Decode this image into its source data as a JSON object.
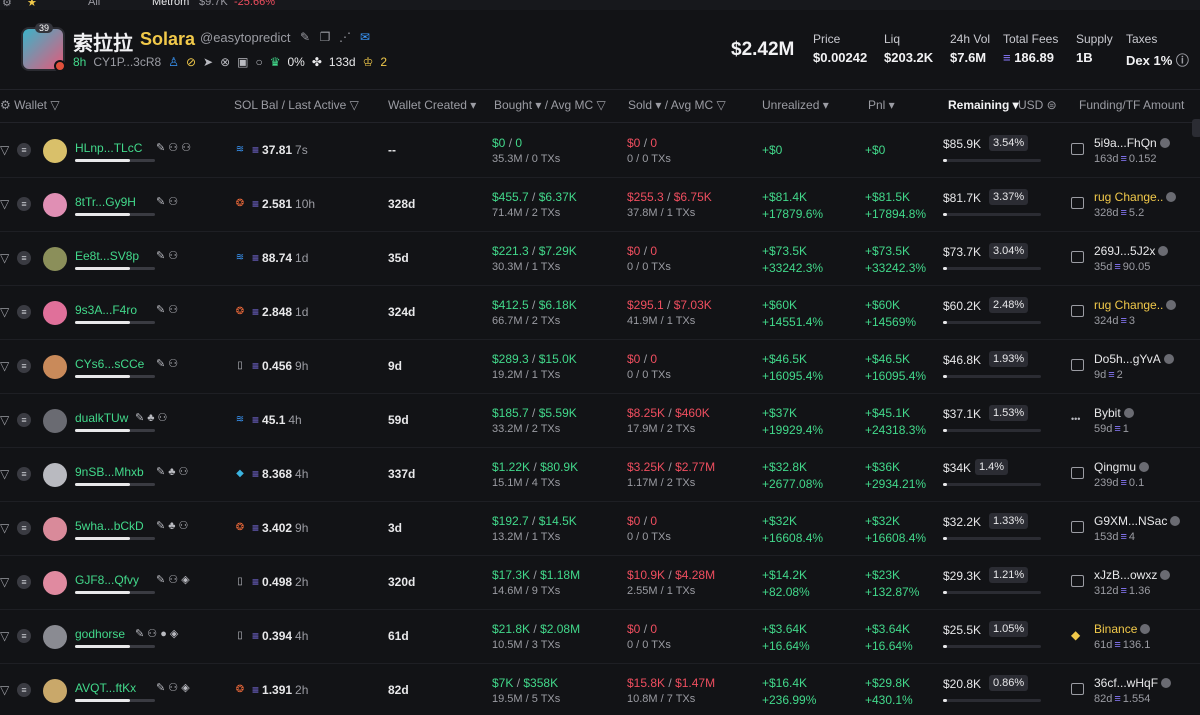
{
  "topbar": {
    "all_label": "All",
    "metrom_label": "Metrom",
    "metrom_mc": "$9.7K",
    "metrom_change": "-25.66%"
  },
  "token": {
    "badge": "39",
    "name": "索拉拉",
    "symbol": "Solara",
    "handle": "@easytopredict",
    "age": "8h",
    "ca": "CY1P...3cR8",
    "holders_pct": "0%",
    "days": "133d",
    "crowns": "2"
  },
  "stats": {
    "market_cap": "$2.42M",
    "price_label": "Price",
    "price": "$0.00242",
    "liq_label": "Liq",
    "liq": "$203.2K",
    "vol_label": "24h Vol",
    "vol": "$7.6M",
    "fees_label": "Total Fees",
    "fees": "186.89",
    "supply_label": "Supply",
    "supply": "1B",
    "taxes_label": "Taxes",
    "taxes": "Dex 1%"
  },
  "columns": {
    "wallet": "Wallet",
    "sol_bal": "SOL Bal",
    "last_active": "Last Active",
    "wallet_created": "Wallet Created",
    "bought": "Bought",
    "bought_avg": "Avg MC",
    "sold": "Sold",
    "sold_avg": "Avg MC",
    "unrealized": "Unrealized",
    "pnl": "Pnl",
    "remaining": "Remaining",
    "usd": "USD",
    "funding": "Funding/TF Amount"
  },
  "colors": {
    "accent_green": "#42d98b",
    "accent_red": "#ef4e5f",
    "sol_purple": "#8b7bff",
    "gold": "#f1c94a"
  },
  "rows": [
    {
      "wallet": "HLnp...TLcC",
      "wicons": "✎ ⚇ ⚇",
      "avatar_color": "#d9c06a",
      "sol_icon": "blue",
      "sol": "37.81",
      "active": "7s",
      "created": "--",
      "bought": "$0",
      "bought_avg": "0",
      "bought_sub": "35.3M / 0 TXs",
      "sold": "$0",
      "sold_avg": "0",
      "sold_sub": "0 / 0 TXs",
      "unreal": "+$0",
      "unreal_pct": "",
      "pnl": "+$0",
      "pnl_pct": "",
      "remaining": "$85.9K",
      "pct": "3.54%",
      "fund_name": "5i9a...FhQn",
      "fund_age": "163d",
      "fund_amt": "0.152",
      "fund_icon": "box"
    },
    {
      "wallet": "8tTr...Gy9H",
      "wicons": "✎ ⚇",
      "avatar_color": "#e08fb4",
      "sol_icon": "orange",
      "sol": "2.581",
      "active": "10h",
      "created": "328d",
      "bought": "$455.7",
      "bought_avg": "$6.37K",
      "bought_sub": "71.4M / 2 TXs",
      "sold": "$255.3",
      "sold_avg": "$6.75K",
      "sold_sub": "37.8M / 1 TXs",
      "unreal": "+$81.4K",
      "unreal_pct": "+17879.6%",
      "pnl": "+$81.5K",
      "pnl_pct": "+17894.8%",
      "remaining": "$81.7K",
      "pct": "3.37%",
      "fund_name": "rug Change..",
      "fund_age": "328d",
      "fund_amt": "5.2",
      "fund_icon": "box",
      "fund_yellow": true
    },
    {
      "wallet": "Ee8t...SV8p",
      "wicons": "✎ ⚇",
      "avatar_color": "#8b8f5a",
      "sol_icon": "blue",
      "sol": "88.74",
      "active": "1d",
      "created": "35d",
      "bought": "$221.3",
      "bought_avg": "$7.29K",
      "bought_sub": "30.3M / 1 TXs",
      "sold": "$0",
      "sold_avg": "0",
      "sold_sub": "0 / 0 TXs",
      "unreal": "+$73.5K",
      "unreal_pct": "+33242.3%",
      "pnl": "+$73.5K",
      "pnl_pct": "+33242.3%",
      "remaining": "$73.7K",
      "pct": "3.04%",
      "fund_name": "269J...5J2x",
      "fund_age": "35d",
      "fund_amt": "90.05",
      "fund_icon": "box"
    },
    {
      "wallet": "9s3A...F4ro",
      "wicons": "✎ ⚇",
      "avatar_color": "#e0709a",
      "sol_icon": "orange",
      "sol": "2.848",
      "active": "1d",
      "created": "324d",
      "bought": "$412.5",
      "bought_avg": "$6.18K",
      "bought_sub": "66.7M / 2 TXs",
      "sold": "$295.1",
      "sold_avg": "$7.03K",
      "sold_sub": "41.9M / 1 TXs",
      "unreal": "+$60K",
      "unreal_pct": "+14551.4%",
      "pnl": "+$60K",
      "pnl_pct": "+14569%",
      "remaining": "$60.2K",
      "pct": "2.48%",
      "fund_name": "rug Change..",
      "fund_age": "324d",
      "fund_amt": "3",
      "fund_icon": "box",
      "fund_yellow": true
    },
    {
      "wallet": "CYs6...sCCe",
      "wicons": "✎ ⚇",
      "avatar_color": "#c98a5a",
      "sol_icon": "plain",
      "sol": "0.456",
      "active": "9h",
      "created": "9d",
      "bought": "$289.3",
      "bought_avg": "$15.0K",
      "bought_sub": "19.2M / 1 TXs",
      "sold": "$0",
      "sold_avg": "0",
      "sold_sub": "0 / 0 TXs",
      "unreal": "+$46.5K",
      "unreal_pct": "+16095.4%",
      "pnl": "+$46.5K",
      "pnl_pct": "+16095.4%",
      "remaining": "$46.8K",
      "pct": "1.93%",
      "fund_name": "Do5h...gYvA",
      "fund_age": "9d",
      "fund_amt": "2",
      "fund_icon": "box"
    },
    {
      "wallet": "dualkTUw",
      "wicons": "✎ ♣ ⚇",
      "avatar_color": "#6a6b72",
      "sol_icon": "blue",
      "sol": "45.1",
      "active": "4h",
      "created": "59d",
      "bought": "$185.7",
      "bought_avg": "$5.59K",
      "bought_sub": "33.2M / 2 TXs",
      "sold": "$8.25K",
      "sold_avg": "$460K",
      "sold_sub": "17.9M / 2 TXs",
      "unreal": "+$37K",
      "unreal_pct": "+19929.4%",
      "pnl": "+$45.1K",
      "pnl_pct": "+24318.3%",
      "remaining": "$37.1K",
      "pct": "1.53%",
      "fund_name": "Bybit",
      "fund_age": "59d",
      "fund_amt": "1",
      "fund_icon": "dots"
    },
    {
      "wallet": "9nSB...Mhxb",
      "wicons": "✎ ♣ ⚇",
      "avatar_color": "#b9bac0",
      "sol_icon": "whale",
      "sol": "8.368",
      "active": "4h",
      "created": "337d",
      "bought": "$1.22K",
      "bought_avg": "$80.9K",
      "bought_sub": "15.1M / 4 TXs",
      "sold": "$3.25K",
      "sold_avg": "$2.77M",
      "sold_sub": "1.17M / 2 TXs",
      "unreal": "+$32.8K",
      "unreal_pct": "+2677.08%",
      "pnl": "+$36K",
      "pnl_pct": "+2934.21%",
      "remaining": "$34K",
      "pct": "1.4%",
      "fund_name": "Qingmu",
      "fund_age": "239d",
      "fund_amt": "0.1",
      "fund_icon": "box"
    },
    {
      "wallet": "5wha...bCkD",
      "wicons": "✎ ♣ ⚇",
      "avatar_color": "#d98a9a",
      "sol_icon": "orange",
      "sol": "3.402",
      "active": "9h",
      "created": "3d",
      "bought": "$192.7",
      "bought_avg": "$14.5K",
      "bought_sub": "13.2M / 1 TXs",
      "sold": "$0",
      "sold_avg": "0",
      "sold_sub": "0 / 0 TXs",
      "unreal": "+$32K",
      "unreal_pct": "+16608.4%",
      "pnl": "+$32K",
      "pnl_pct": "+16608.4%",
      "remaining": "$32.2K",
      "pct": "1.33%",
      "fund_name": "G9XM...NSac",
      "fund_age": "153d",
      "fund_amt": "4",
      "fund_icon": "box"
    },
    {
      "wallet": "GJF8...Qfvy",
      "wicons": "✎ ⚇ ◈",
      "avatar_color": "#e08aa0",
      "sol_icon": "plain",
      "sol": "0.498",
      "active": "2h",
      "created": "320d",
      "bought": "$17.3K",
      "bought_avg": "$1.18M",
      "bought_sub": "14.6M / 9 TXs",
      "sold": "$10.9K",
      "sold_avg": "$4.28M",
      "sold_sub": "2.55M / 1 TXs",
      "unreal": "+$14.2K",
      "unreal_pct": "+82.08%",
      "pnl": "+$23K",
      "pnl_pct": "+132.87%",
      "remaining": "$29.3K",
      "pct": "1.21%",
      "fund_name": "xJzB...owxz",
      "fund_age": "312d",
      "fund_amt": "1.36",
      "fund_icon": "box"
    },
    {
      "wallet": "godhorse",
      "wicons": "✎ ⚇ ● ◈",
      "avatar_color": "#8a8b92",
      "sol_icon": "plain",
      "sol": "0.394",
      "active": "4h",
      "created": "61d",
      "bought": "$21.8K",
      "bought_avg": "$2.08M",
      "bought_sub": "10.5M / 3 TXs",
      "sold": "$0",
      "sold_avg": "0",
      "sold_sub": "0 / 0 TXs",
      "unreal": "+$3.64K",
      "unreal_pct": "+16.64%",
      "pnl": "+$3.64K",
      "pnl_pct": "+16.64%",
      "remaining": "$25.5K",
      "pct": "1.05%",
      "fund_name": "Binance",
      "fund_age": "61d",
      "fund_amt": "136.1",
      "fund_icon": "bin",
      "fund_yellow": true
    },
    {
      "wallet": "AVQT...ftKx",
      "wicons": "✎ ⚇ ◈",
      "avatar_color": "#c9a86a",
      "sol_icon": "orange",
      "sol": "1.391",
      "active": "2h",
      "created": "82d",
      "bought": "$7K",
      "bought_avg": "$358K",
      "bought_sub": "19.5M / 5 TXs",
      "sold": "$15.8K",
      "sold_avg": "$1.47M",
      "sold_sub": "10.8M / 7 TXs",
      "unreal": "+$16.4K",
      "unreal_pct": "+236.99%",
      "pnl": "+$29.8K",
      "pnl_pct": "+430.1%",
      "remaining": "$20.8K",
      "pct": "0.86%",
      "fund_name": "36cf...wHqF",
      "fund_age": "82d",
      "fund_amt": "1.554",
      "fund_icon": "box"
    }
  ]
}
